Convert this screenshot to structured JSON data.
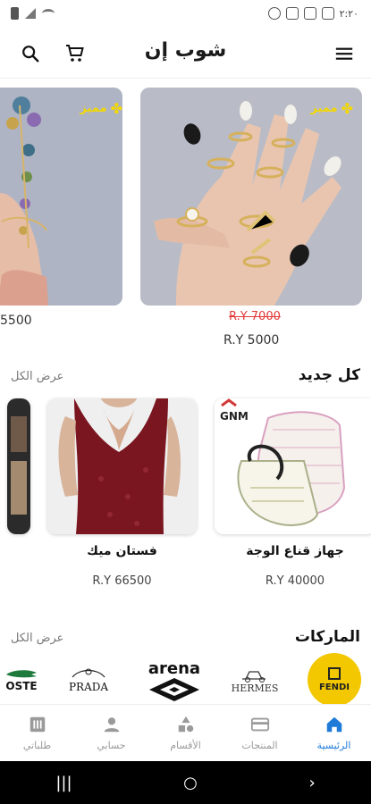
{
  "status_bar": {
    "time": "٢:٢٠"
  },
  "app_bar": {
    "title": "شوب إن"
  },
  "offers": [
    {
      "badge": "مميز",
      "old_price": "R.Y  7000",
      "price": "R.Y  5000"
    },
    {
      "badge": "مميز",
      "price": "5500"
    }
  ],
  "new_section": {
    "title": "كل جديد",
    "view_all": "عرض الكل"
  },
  "products": [
    {
      "name": "جهاز قناع الوجة",
      "price": "R.Y  40000",
      "brand_tag": "GNM"
    },
    {
      "name": "فستان ميك",
      "price": "R.Y  66500"
    }
  ],
  "brands_section": {
    "title": "الماركات",
    "view_all": "عرض الكل"
  },
  "brands": [
    {
      "name": "FENDI"
    },
    {
      "name": "HERMES"
    },
    {
      "name": "arena"
    },
    {
      "name": "PRADA"
    },
    {
      "name": "OSTE"
    }
  ],
  "bottom_nav": [
    {
      "label": "الرئيسية",
      "icon": "home-icon",
      "active": true
    },
    {
      "label": "المنتجات",
      "icon": "products-icon",
      "active": false
    },
    {
      "label": "الأقسام",
      "icon": "categories-icon",
      "active": false
    },
    {
      "label": "حسابي",
      "icon": "account-icon",
      "active": false
    },
    {
      "label": "طلباتي",
      "icon": "orders-icon",
      "active": false
    }
  ],
  "colors": {
    "accent": "#1f7bd8",
    "badge": "#f4d800",
    "old_price": "#e23a3a",
    "fendi": "#f3c800"
  }
}
